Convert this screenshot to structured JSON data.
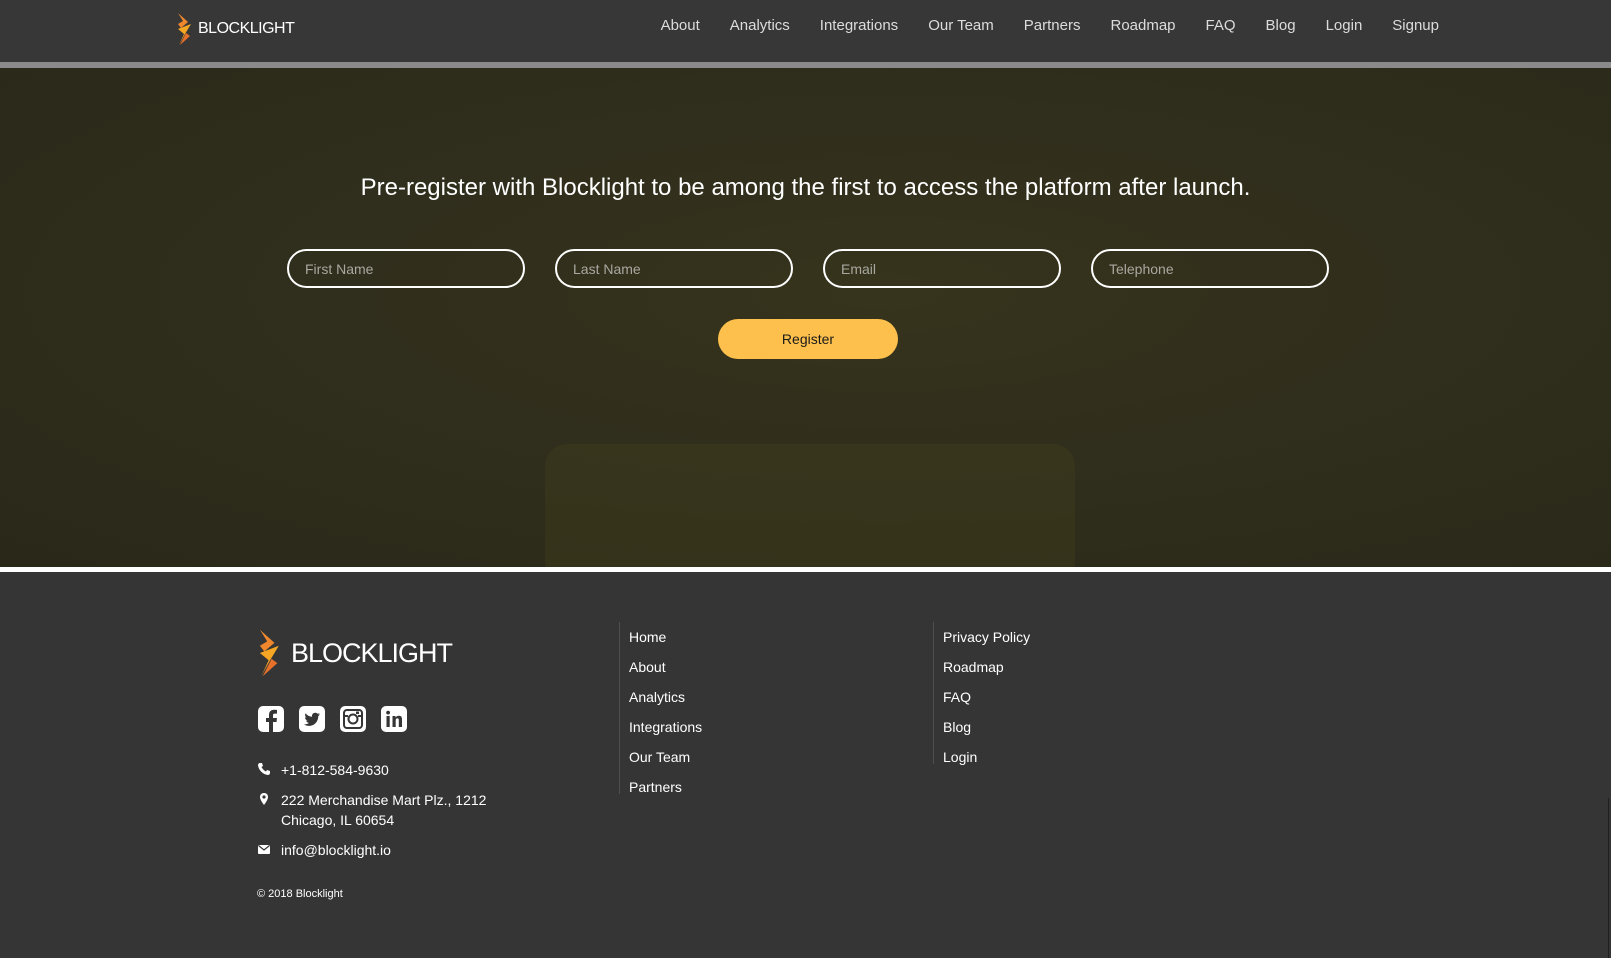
{
  "brand": {
    "name": "BLOCKLIGHT",
    "accent_color": "#fec04c",
    "logo_colors": [
      "#f0872d",
      "#f5a623"
    ]
  },
  "nav": {
    "items": [
      "About",
      "Analytics",
      "Integrations",
      "Our Team",
      "Partners",
      "Roadmap",
      "FAQ",
      "Blog",
      "Login",
      "Signup"
    ]
  },
  "hero": {
    "title": "Pre-register with Blocklight to be among the first to access the platform after launch.",
    "fields": {
      "first_name": "First Name",
      "last_name": "Last Name",
      "email": "Email",
      "telephone": "Telephone"
    },
    "register_label": "Register"
  },
  "footer": {
    "social": [
      "facebook-icon",
      "twitter-icon",
      "instagram-icon",
      "linkedin-icon"
    ],
    "phone": "+1-812-584-9630",
    "address_line1": "222 Merchandise Mart Plz., 1212",
    "address_line2": "Chicago, IL 60654",
    "email": "info@blocklight.io",
    "copyright": "© 2018 Blocklight",
    "links_col1": [
      "Home",
      "About",
      "Analytics",
      "Integrations",
      "Our Team",
      "Partners"
    ],
    "links_col2": [
      "Privacy Policy",
      "Roadmap",
      "FAQ",
      "Blog",
      "Login"
    ]
  }
}
